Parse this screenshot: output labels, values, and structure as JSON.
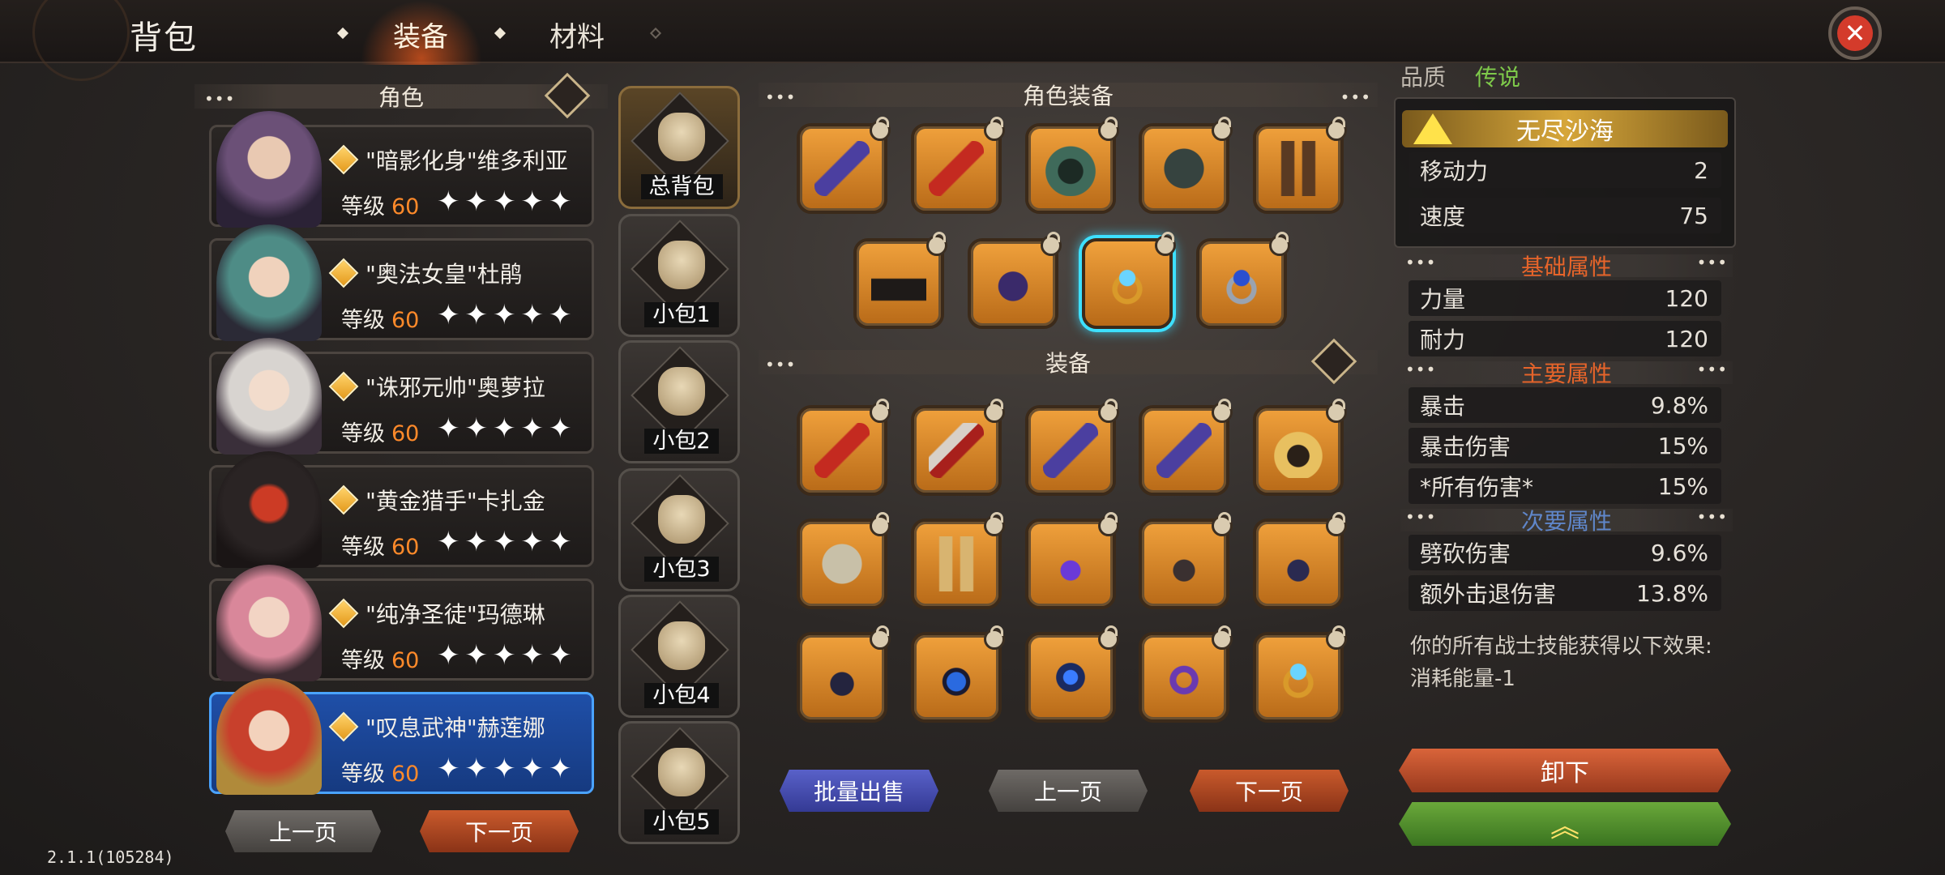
{
  "header": {
    "title": "背包",
    "tabs": [
      {
        "label": "装备",
        "active": true
      },
      {
        "label": "材料",
        "active": false
      }
    ]
  },
  "roles": {
    "section_title": "角色",
    "characters": [
      {
        "name": "\"暗影化身\"维多利亚",
        "level_label": "等级",
        "level": "60",
        "stars": "✦✦✦✦✦",
        "selected": false
      },
      {
        "name": "\"奥法女皇\"杜鹃",
        "level_label": "等级",
        "level": "60",
        "stars": "✦✦✦✦✦",
        "selected": false
      },
      {
        "name": "\"诛邪元帅\"奥萝拉",
        "level_label": "等级",
        "level": "60",
        "stars": "✦✦✦✦✦",
        "selected": false
      },
      {
        "name": "\"黄金猎手\"卡扎金",
        "level_label": "等级",
        "level": "60",
        "stars": "✦✦✦✦✦",
        "selected": false
      },
      {
        "name": "\"纯净圣徒\"玛德琳",
        "level_label": "等级",
        "level": "60",
        "stars": "✦✦✦✦✦",
        "selected": false
      },
      {
        "name": "\"叹息武神\"赫莲娜",
        "level_label": "等级",
        "level": "60",
        "stars": "✦✦✦✦✦",
        "selected": true
      }
    ],
    "prev": "上一页",
    "next": "下一页"
  },
  "bags": [
    {
      "label": "总背包",
      "active": true
    },
    {
      "label": "小包1",
      "active": false
    },
    {
      "label": "小包2",
      "active": false
    },
    {
      "label": "小包3",
      "active": false
    },
    {
      "label": "小包4",
      "active": false
    },
    {
      "label": "小包5",
      "active": false
    }
  ],
  "character_equipment": {
    "section_title": "角色装备",
    "slots": [
      "purple-sword",
      "red-sword",
      "green-hood",
      "dark-armor",
      "leather-gloves",
      "black-boots",
      "purple-amulet",
      "blue-gem-ring",
      "blue-sapphire-ring"
    ]
  },
  "inventory": {
    "section_title": "装备",
    "items": [
      "red-sword",
      "red-axe",
      "purple-sword",
      "purple-sword",
      "gold-helmet",
      "silver-armor",
      "gold-gloves",
      "purple-necklace",
      "dark-necklace",
      "dark-necklace",
      "dark-necklace",
      "blue-necklace",
      "blue-flame-gem",
      "purple-ring",
      "blue-gem-ring"
    ],
    "bulk_sell": "批量出售",
    "prev": "上一页",
    "next": "下一页"
  },
  "item_detail": {
    "quality_label": "品质",
    "quality_value": "传说",
    "set_name": "无尽沙海",
    "header_stats": [
      {
        "label": "移动力",
        "value": "2"
      },
      {
        "label": "速度",
        "value": "75"
      }
    ],
    "base_title": "基础属性",
    "base_stats": [
      {
        "label": "力量",
        "value": "120"
      },
      {
        "label": "耐力",
        "value": "120"
      }
    ],
    "main_title": "主要属性",
    "main_stats": [
      {
        "label": "暴击",
        "value": "9.8%"
      },
      {
        "label": "暴击伤害",
        "value": "15%"
      },
      {
        "label": "*所有伤害*",
        "value": "15%"
      }
    ],
    "sub_title": "次要属性",
    "sub_stats": [
      {
        "label": "劈砍伤害",
        "value": "9.6%"
      },
      {
        "label": "额外击退伤害",
        "value": "13.8%"
      }
    ],
    "effect_text": "你的所有战士技能获得以下效果:\n消耗能量-1",
    "unequip": "卸下",
    "upgrade": "︽"
  },
  "version": "2.1.1(105284)",
  "colors": {
    "accent_orange": "#ff8a2a",
    "section_orange": "#e6642a",
    "section_blue": "#5f86c9",
    "quality_green": "#7ec94a",
    "selected_blue": "#1f4fa8"
  }
}
